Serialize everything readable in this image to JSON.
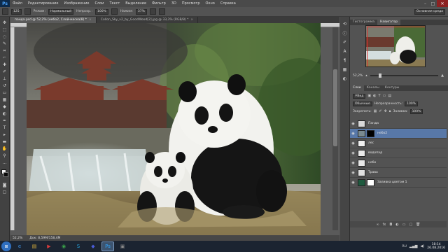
{
  "menubar": {
    "logo": "Ps",
    "items": [
      "Файл",
      "Редактирование",
      "Изображение",
      "Слои",
      "Текст",
      "Выделение",
      "Фильтр",
      "3D",
      "Просмотр",
      "Окно",
      "Справка"
    ],
    "minimize_glyph": "–",
    "maximize_glyph": "□",
    "close_glyph": "✕"
  },
  "options": {
    "brush_size": "125",
    "mode_label": "Режим:",
    "mode_value": "Нормальный",
    "opacity_label": "Непрозр.:",
    "opacity_value": "100%",
    "flow_label": "Нажим:",
    "flow_value": "37%",
    "workspace": "Основная среда"
  },
  "tabs": {
    "active": "панда.psd @ 52,2% (небо2, Слой-маска/8) *",
    "active_close": "×",
    "second": "Collon_Sky_v2_by_GoodWood[2].jpg @ 33,3% (RGB/8) *",
    "second_close": "×"
  },
  "status": {
    "zoom": "52,2%",
    "doc_size": "Док: 8,59M/158,4M"
  },
  "navigator": {
    "tab_histogram": "Гистограмма",
    "tab_navigator": "Навигатор",
    "zoom": "52,2%"
  },
  "layers_panel": {
    "tab_layers": "Слои",
    "tab_channels": "Каналы",
    "tab_paths": "Контуры",
    "filter_label": "Вид",
    "blend_mode": "Обычные",
    "opacity_label": "Непрозрачность:",
    "opacity_value": "100%",
    "lock_label": "Закрепить:",
    "fill_label": "Заливка:",
    "fill_value": "100%",
    "layers": [
      {
        "name": "Панда",
        "thumb_color": "#d8d8d8",
        "selected": false,
        "mask": "none"
      },
      {
        "name": "небо2",
        "thumb_color": "#7a8a90",
        "selected": true,
        "mask": "black"
      },
      {
        "name": "лес",
        "thumb_color": "#f0f0f0",
        "selected": false,
        "mask": "none"
      },
      {
        "name": "водопад",
        "thumb_color": "#e8e8e8",
        "selected": false,
        "mask": "none"
      },
      {
        "name": "небо",
        "thumb_color": "#e8e8e8",
        "selected": false,
        "mask": "none"
      },
      {
        "name": "Трава",
        "thumb_color": "#e0e0e0",
        "selected": false,
        "mask": "none"
      },
      {
        "name": "Заливка цветом 1",
        "thumb_color": "#1f5a3f",
        "selected": false,
        "mask": "white"
      }
    ]
  },
  "taskbar": {
    "start_glyph": "⊞",
    "lang": "RU",
    "time": "18:14",
    "date": "26.08.2016",
    "apps": [
      {
        "glyph": "e",
        "color": "#3b8ad9",
        "active": false
      },
      {
        "glyph": "▤",
        "color": "#e0b43c",
        "active": false
      },
      {
        "glyph": "▶",
        "color": "#d83b3b",
        "active": false
      },
      {
        "glyph": "◉",
        "color": "#3ca64b",
        "active": false
      },
      {
        "glyph": "S",
        "color": "#27a0d8",
        "active": false
      },
      {
        "glyph": "◆",
        "color": "#4b5dd8",
        "active": false
      },
      {
        "glyph": "Ps",
        "color": "#31a8ff",
        "active": true
      },
      {
        "glyph": "▣",
        "color": "#8a8a8a",
        "active": false
      }
    ]
  }
}
